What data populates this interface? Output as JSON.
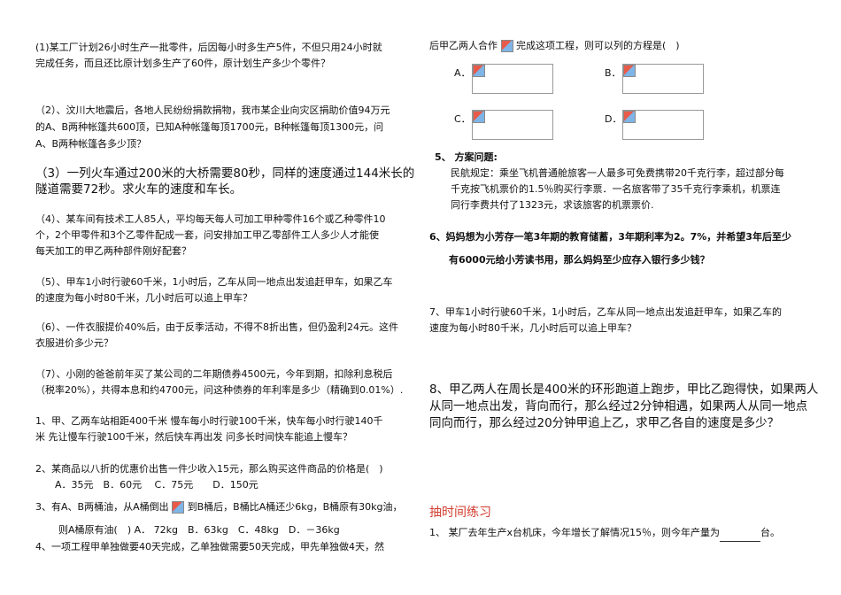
{
  "left": {
    "q1": [
      "(1)某工厂计划26小时生产一批零件，后因每小时多生产5件，不但只用24小时就",
      "完成任务，而且还比原计划多生产了60件，原计划生产多少个零件？"
    ],
    "q2": [
      "（2）、汶川大地震后，各地人民纷纷捐款捐物，我市某企业向灾区捐助价值94万元",
      "的A、B两种帐篷共600顶，已知A种帐篷每顶1700元，B种帐篷每顶1300元，问",
      "A、B两种帐篷各多少顶？"
    ],
    "q3": [
      "（3）一列火车通过200米的大桥需要80秒，同样的速度通过144米长的",
      "隧道需要72秒。求火车的速度和车长。"
    ],
    "q4": [
      "（4）、某车间有技术工人85人，平均每天每人可加工甲种零件16个或乙种零件10",
      "个，2个甲零件和3个乙零件配成一套，问安排加工甲乙零部件工人多少人才能使",
      "每天加工的甲乙两种部件刚好配套？"
    ],
    "q5": [
      "（5）、甲车1小时行驶60千米，1小时后，乙车从同一地点出发追赶甲车，如果乙车",
      "的速度为每小时80千米，几小时后可以追上甲车？"
    ],
    "q6": [
      "（6）、一件衣服提价40%后，由于反季活动，不得不8折出售，但仍盈利24元。这件",
      "衣服进价多少元？"
    ],
    "q7": [
      "（7）、小刚的爸爸前年买了某公司的二年期债券4500元，今年到期，扣除利息税后",
      "（税率20%），共得本息和约4700元，问这种债券的年利率是多少（精确到0.01%）."
    ],
    "s1": [
      "1、甲、乙两车站相距400千米 慢车每小时行驶100千米，快车每小时行驶140千",
      "米 先让慢车行驶100千米，然后快车再出发 问多长时间快车能追上慢车？"
    ],
    "s2": "2、某商品以八折的优惠价出售一件少收入15元，那么购买这件商品的价格是(　)",
    "s2_opts": "A．35元　B．60元　 C．75元　　D．150元",
    "s3_a": "3、有A、B两桶油，从A桶倒出",
    "s3_b": "到B桶后，B桶比A桶还少6kg，B桶原有30kg油，",
    "s3_c": "则A桶原有油(　) A． 72kg　B．63kg　C．48kg　D．－36kg",
    "s4": "4、一项工程甲单独做要40天完成，乙单独做需要50天完成，甲先单独做4天，然"
  },
  "right": {
    "cont_a": "后甲乙两人合作",
    "cont_b": "完成这项工程，则可以列的方程是(　)",
    "opts": [
      "A．",
      "B．",
      "C．",
      "D．"
    ],
    "q5_title": "5、 方案问题:",
    "q5_body": [
      "民航规定：乘坐飞机普通舱旅客一人最多可免费携带20千克行李，超过部分每",
      "千克按飞机票价的1.5％购买行李票．一名旅客带了35千克行李乘机，机票连",
      "同行李费共付了1323元，求该旅客的机票票价."
    ],
    "q6": [
      "6、妈妈想为小芳存一笔3年期的教育储蓄，3年期利率为2。7%，并希望3年后至少",
      "有6000元给小芳读书用，那么妈妈至少应存入银行多少钱？"
    ],
    "q7": [
      "7、甲车1小时行驶60千米，1小时后，乙车从同一地点出发追赶甲车，如果乙车的",
      "速度为每小时80千米，几小时后可以追上甲车？"
    ],
    "q8": [
      "8、甲乙两人在周长是400米的环形跑道上跑步，甲比乙跑得快，如果两人",
      "从同一地点出发，背向而行，那么经过2分钟相遇，如果两人从同一地点",
      "同向而行，那么经过20分钟甲追上乙，求甲乙各自的速度是多少？"
    ],
    "practice_title": "抽时间练习",
    "practice_q1_a": "1、 某厂去年生产x台机床，今年增长了解情况15％，则今年产量为",
    "practice_q1_b": "台。"
  }
}
